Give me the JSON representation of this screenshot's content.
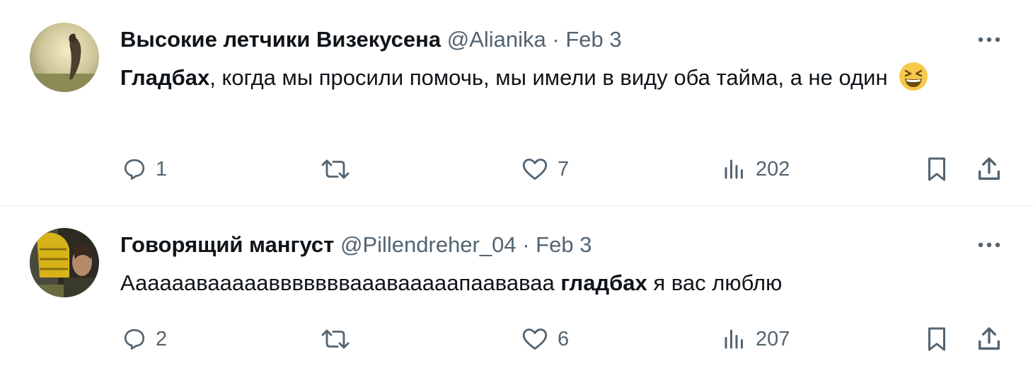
{
  "tweets": [
    {
      "display_name": "Высокие летчики Визекусена",
      "handle": "@Alianika",
      "separator": "·",
      "date": "Feb 3",
      "text_bold": "Гладбах",
      "text_rest": ", когда мы просили помочь, мы имели в виду оба тайма, а не один",
      "emoji": "grinning-squinting-face",
      "counts": {
        "replies": "1",
        "retweets": "",
        "likes": "7",
        "views": "202"
      }
    },
    {
      "display_name": "Говорящий мангуст",
      "handle": "@Pillendreher_04",
      "separator": "·",
      "date": "Feb 3",
      "text_before": "Аааааавааааавввввввааавааааапаававаа",
      "text_bold": "гладбах",
      "text_after": "я вас люблю",
      "counts": {
        "replies": "2",
        "retweets": "",
        "likes": "6",
        "views": "207"
      }
    }
  ],
  "icons": {
    "more": "more-horizontal-icon",
    "reply": "reply-bubble-icon",
    "retweet": "retweet-icon",
    "like": "heart-icon",
    "views": "bar-chart-icon",
    "bookmark": "bookmark-icon",
    "share": "share-upload-icon"
  },
  "colors": {
    "text": "#0f1419",
    "muted": "#536471",
    "separator": "#eff3f4",
    "emoji": "#f7c84a"
  }
}
